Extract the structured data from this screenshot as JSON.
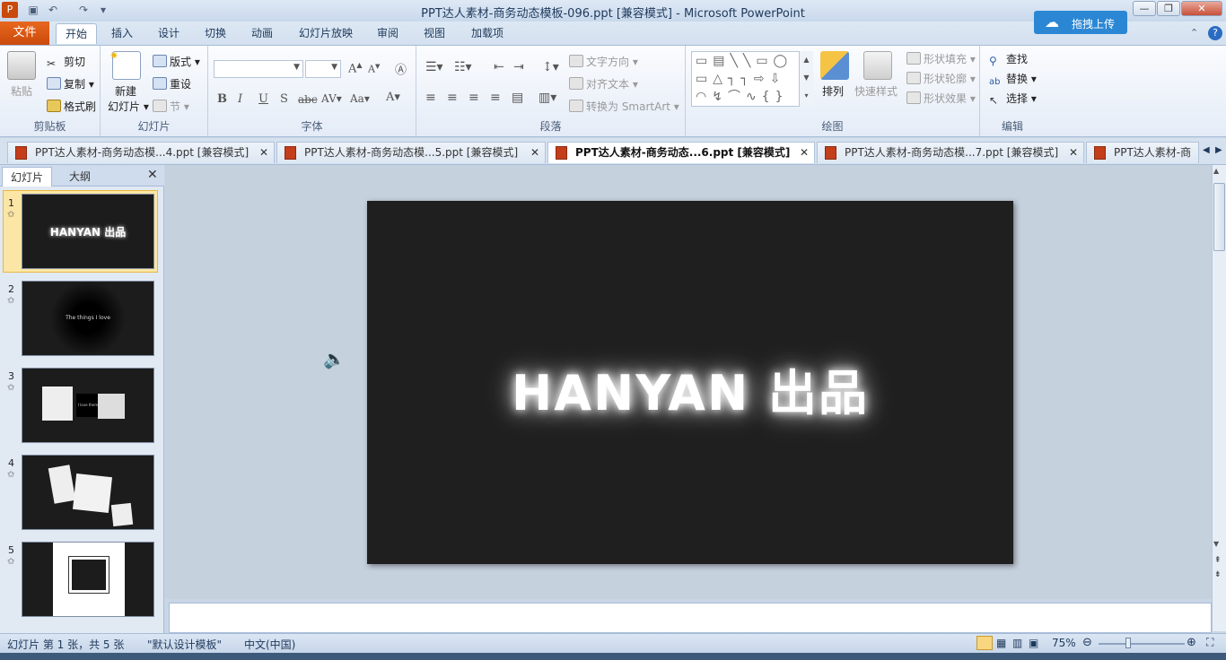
{
  "app": {
    "window_title": "PPT达人素材-商务动态模板-096.ppt [兼容模式]  -  Microsoft PowerPoint",
    "upload_button": "拖拽上传"
  },
  "ribbon_tabs": [
    "文件",
    "开始",
    "插入",
    "设计",
    "切换",
    "动画",
    "幻灯片放映",
    "审阅",
    "视图",
    "加载项"
  ],
  "groups": {
    "clipboard": {
      "label": "剪贴板",
      "paste": "粘贴",
      "cut": "剪切",
      "copy": "复制",
      "format_painter": "格式刷"
    },
    "slides": {
      "label": "幻灯片",
      "new_slide_1": "新建",
      "new_slide_2": "幻灯片",
      "layout": "版式",
      "reset": "重设",
      "section": "节"
    },
    "font": {
      "label": "字体"
    },
    "paragraph": {
      "label": "段落",
      "text_direction": "文字方向",
      "align_text": "对齐文本",
      "smartart": "转换为 SmartArt"
    },
    "drawing": {
      "label": "绘图",
      "arrange": "排列",
      "quick_styles": "快速样式",
      "shape_fill": "形状填充",
      "shape_outline": "形状轮廓",
      "shape_effects": "形状效果"
    },
    "editing": {
      "label": "编辑",
      "find": "查找",
      "replace": "替换",
      "select": "选择"
    }
  },
  "doc_tabs": [
    {
      "label": "PPT达人素材-商务动态模...4.ppt [兼容模式]"
    },
    {
      "label": "PPT达人素材-商务动态模...5.ppt [兼容模式]"
    },
    {
      "label": "PPT达人素材-商务动态...6.ppt [兼容模式]"
    },
    {
      "label": "PPT达人素材-商务动态模...7.ppt [兼容模式]"
    },
    {
      "label": "PPT达人素材-商务"
    }
  ],
  "left_pane": {
    "tab_slides": "幻灯片",
    "tab_outline": "大纲"
  },
  "thumbnails": [
    {
      "num": "1",
      "text": "HANYAN 出品"
    },
    {
      "num": "2",
      "text": "The things I love"
    },
    {
      "num": "3",
      "text": "I love them"
    },
    {
      "num": "4",
      "text": ""
    },
    {
      "num": "5",
      "text": ""
    }
  ],
  "slide": {
    "title": "HANYAN 出品"
  },
  "status": {
    "slide_info": "幻灯片 第 1 张，共 5 张",
    "theme": "\"默认设计模板\"",
    "language": "中文(中国)",
    "zoom": "75%"
  },
  "colors": {
    "file_tab": "#d65a14",
    "accent": "#1e395b",
    "slide_bg": "#1f1f1f"
  }
}
